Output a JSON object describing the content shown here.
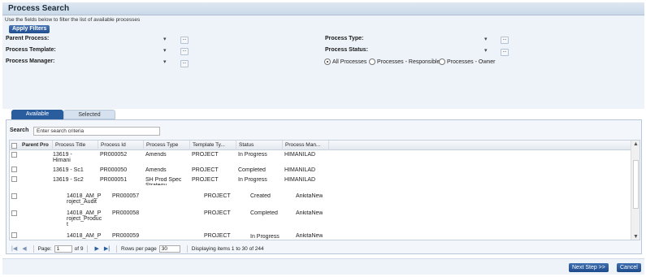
{
  "header": {
    "title": "Process Search"
  },
  "filters": {
    "hint": "Use the fields below to filter the list of available processes",
    "apply_label": "Apply Filters",
    "parent_process": "Parent Process:",
    "process_template": "Process Template:",
    "process_manager": "Process Manager:",
    "process_type": "Process Type:",
    "process_status": "Process Status:",
    "radio_all": "All Processes",
    "radio_responsible": "Processes - Responsible",
    "radio_owner": "Processes - Owner",
    "selected_radio": "All Processes"
  },
  "tabs": {
    "available": "Available",
    "selected": "Selected"
  },
  "search": {
    "label": "Search",
    "placeholder": "Enter search criteria"
  },
  "table": {
    "headers": [
      "Parent Pro",
      "Process Title",
      "Process Id",
      "Process Type",
      "Template Ty...",
      "Status",
      "Process Man..."
    ],
    "rows": [
      {
        "title": "13619 -\nHimani",
        "id": "PR000052",
        "type": "Amends",
        "template": "PROJECT",
        "status": "In Progress",
        "manager": "HIMANILAD"
      },
      {
        "title": "13619 - Sc1",
        "id": "PR000050",
        "type": "Amends",
        "template": "PROJECT",
        "status": "Completed",
        "manager": "HIMANILAD"
      },
      {
        "title": "13619 - Sc2",
        "id": "PR000051",
        "type": "SH Prod Spec\nStrategy",
        "template": "PROJECT",
        "status": "In Progress",
        "manager": "HIMANILAD"
      },
      {
        "title": "14018_AM_P\nroject_Audit",
        "id": "PR000057",
        "type": "",
        "template": "PROJECT",
        "status": "Created",
        "manager": "AnkitaNew"
      },
      {
        "title": "14018_AM_P\nroject_Produc\nt",
        "id": "PR000058",
        "type": "",
        "template": "PROJECT",
        "status": "Completed",
        "manager": "AnkitaNew"
      },
      {
        "title": "14018_AM_P",
        "id": "PR000059",
        "type": "",
        "template": "PROJECT",
        "status": "In Progress",
        "manager": "AnkitaNew"
      }
    ]
  },
  "pager": {
    "page_label": "Page:",
    "page_value": "1",
    "of_label": "of 9",
    "rows_label": "Rows per page",
    "rows_value": "30",
    "display_text": "Displaying items 1 to 30 of 244"
  },
  "footer": {
    "next_label": "Next Step >>",
    "cancel_label": "Cancel"
  },
  "colors": {
    "accent": "#2a5d9e",
    "panel_bg": "#eef3f9"
  }
}
